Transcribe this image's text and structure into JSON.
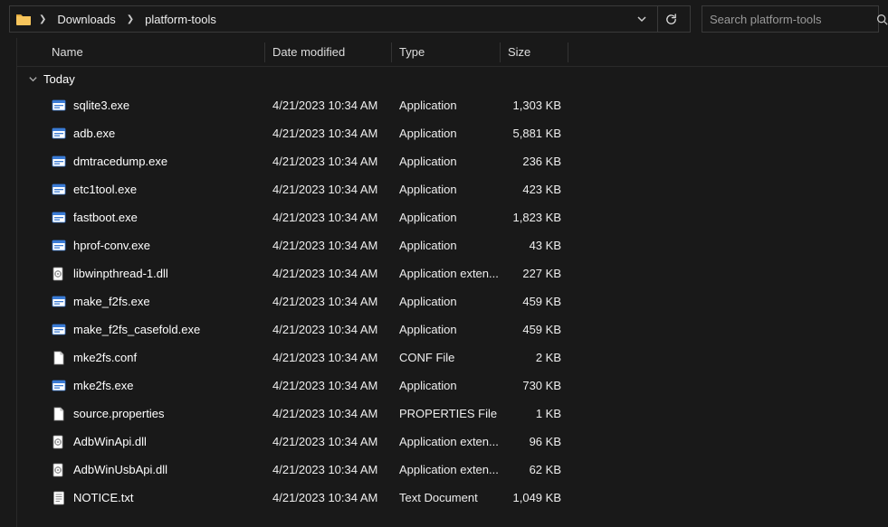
{
  "breadcrumb": {
    "segments": [
      "Downloads",
      "platform-tools"
    ]
  },
  "search": {
    "placeholder": "Search platform-tools"
  },
  "columns": {
    "name": "Name",
    "date": "Date modified",
    "type": "Type",
    "size": "Size"
  },
  "group": {
    "label": "Today"
  },
  "files": [
    {
      "icon": "exe",
      "name": "sqlite3.exe",
      "date": "4/21/2023 10:34 AM",
      "type": "Application",
      "size": "1,303 KB"
    },
    {
      "icon": "exe",
      "name": "adb.exe",
      "date": "4/21/2023 10:34 AM",
      "type": "Application",
      "size": "5,881 KB"
    },
    {
      "icon": "exe",
      "name": "dmtracedump.exe",
      "date": "4/21/2023 10:34 AM",
      "type": "Application",
      "size": "236 KB"
    },
    {
      "icon": "exe",
      "name": "etc1tool.exe",
      "date": "4/21/2023 10:34 AM",
      "type": "Application",
      "size": "423 KB"
    },
    {
      "icon": "exe",
      "name": "fastboot.exe",
      "date": "4/21/2023 10:34 AM",
      "type": "Application",
      "size": "1,823 KB"
    },
    {
      "icon": "exe",
      "name": "hprof-conv.exe",
      "date": "4/21/2023 10:34 AM",
      "type": "Application",
      "size": "43 KB"
    },
    {
      "icon": "dll",
      "name": "libwinpthread-1.dll",
      "date": "4/21/2023 10:34 AM",
      "type": "Application exten...",
      "size": "227 KB"
    },
    {
      "icon": "exe",
      "name": "make_f2fs.exe",
      "date": "4/21/2023 10:34 AM",
      "type": "Application",
      "size": "459 KB"
    },
    {
      "icon": "exe",
      "name": "make_f2fs_casefold.exe",
      "date": "4/21/2023 10:34 AM",
      "type": "Application",
      "size": "459 KB"
    },
    {
      "icon": "file",
      "name": "mke2fs.conf",
      "date": "4/21/2023 10:34 AM",
      "type": "CONF File",
      "size": "2 KB"
    },
    {
      "icon": "exe",
      "name": "mke2fs.exe",
      "date": "4/21/2023 10:34 AM",
      "type": "Application",
      "size": "730 KB"
    },
    {
      "icon": "file",
      "name": "source.properties",
      "date": "4/21/2023 10:34 AM",
      "type": "PROPERTIES File",
      "size": "1 KB"
    },
    {
      "icon": "dll",
      "name": "AdbWinApi.dll",
      "date": "4/21/2023 10:34 AM",
      "type": "Application exten...",
      "size": "96 KB"
    },
    {
      "icon": "dll",
      "name": "AdbWinUsbApi.dll",
      "date": "4/21/2023 10:34 AM",
      "type": "Application exten...",
      "size": "62 KB"
    },
    {
      "icon": "txt",
      "name": "NOTICE.txt",
      "date": "4/21/2023 10:34 AM",
      "type": "Text Document",
      "size": "1,049 KB"
    }
  ]
}
